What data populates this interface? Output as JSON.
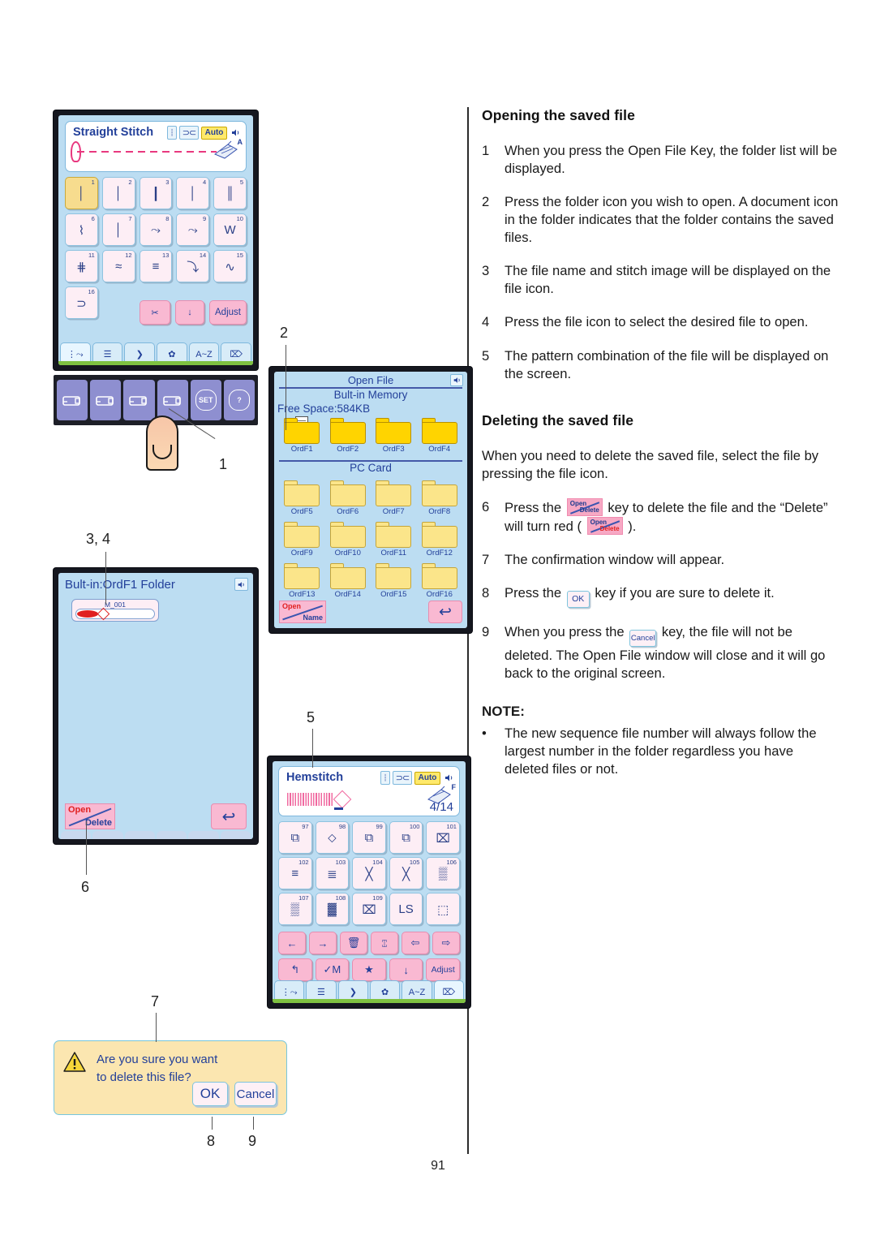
{
  "page": {
    "number": "91"
  },
  "sections": [
    {
      "heading": "Opening the saved file",
      "steps": [
        {
          "num": "1",
          "text": "When you press the Open File Key, the folder list will be displayed."
        },
        {
          "num": "2",
          "text": "Press the folder icon you wish to open. A document icon in the folder indicates that the folder contains the saved files."
        },
        {
          "num": "3",
          "text": "The file name and stitch image will be displayed on the file icon."
        },
        {
          "num": "4",
          "text": "Press the file icon to select the desired file to open."
        },
        {
          "num": "5",
          "text": "The pattern combination of the file will be displayed on the screen."
        }
      ]
    }
  ],
  "deleting": {
    "heading": "Deleting the saved file",
    "intro": "When you need to delete the saved file, select the file by pressing the file icon.",
    "step6_a": "Press the",
    "step6_b": "key to delete the file and the",
    "step6_c": "“Delete” will turn red (",
    "step6_d": ").",
    "step7": "The confirmation window will appear.",
    "step8_a": "Press the",
    "step8_b": "key if you are sure to delete it.",
    "step9_a": "When you press the",
    "step9_b": "key, the file will not be deleted.",
    "step9_c": "The Open File window will close and it will go back to the original screen.",
    "nums": {
      "n6": "6",
      "n7": "7",
      "n8": "8",
      "n9": "9"
    },
    "keys": {
      "open": "Open",
      "delete": "Delete",
      "ok": "OK",
      "cancel": "Cancel"
    }
  },
  "note": {
    "title": "NOTE:",
    "bullet_char": "•",
    "text": "The new sequence file number will always follow the largest number in the folder regardless you have deleted files or not."
  },
  "screen1": {
    "title": "Straight Stitch",
    "indicators": {
      "needle": "needle-position",
      "width": "⊃⊂",
      "auto": "Auto",
      "speaker": "◂"
    },
    "foot_letter": "A",
    "stitches": [
      {
        "n": "1",
        "g": "│",
        "sel": true
      },
      {
        "n": "2",
        "g": "│"
      },
      {
        "n": "3",
        "g": "┃"
      },
      {
        "n": "4",
        "g": "│"
      },
      {
        "n": "5",
        "g": "║"
      },
      {
        "n": "6",
        "g": "⌇"
      },
      {
        "n": "7",
        "g": "│"
      },
      {
        "n": "8",
        "g": "⤳"
      },
      {
        "n": "9",
        "g": "⤳"
      },
      {
        "n": "10",
        "g": "W"
      },
      {
        "n": "11",
        "g": "⋕"
      },
      {
        "n": "12",
        "g": "≈"
      },
      {
        "n": "13",
        "g": "≡"
      },
      {
        "n": "14",
        "g": "⤵"
      },
      {
        "n": "15",
        "g": "∿"
      },
      {
        "n": "16",
        "g": "⊃"
      }
    ],
    "fn_keys": [
      {
        "label": "✂",
        "name": "thread-cut-key"
      },
      {
        "label": "↓",
        "name": "needle-up-down-key"
      },
      {
        "label": "Adjust",
        "name": "adjust-key"
      }
    ],
    "tabs": [
      {
        "label": "⋮⤳",
        "name": "tab-utility-stitch",
        "active": true
      },
      {
        "label": "☰",
        "name": "tab-buttonhole"
      },
      {
        "label": "❯",
        "name": "tab-applique"
      },
      {
        "label": "✿",
        "name": "tab-decorative"
      },
      {
        "label": "A~Z",
        "name": "tab-monogram"
      },
      {
        "label": "⌦",
        "name": "tab-shirt"
      }
    ],
    "hard_keys": [
      {
        "label": "⎙",
        "name": "machine-mode-key"
      },
      {
        "label": "⎙",
        "name": "embroidery-key"
      },
      {
        "label": "⎙",
        "name": "pc-link-key"
      },
      {
        "label": "⎙",
        "name": "open-file-key"
      },
      {
        "label": "SET",
        "name": "set-key"
      },
      {
        "label": "?",
        "name": "help-key"
      }
    ]
  },
  "screen2": {
    "title": "Open File",
    "section_builtin": "Bult-in Memory",
    "free_space": "Free Space:584KB",
    "section_pccard": "PC Card",
    "builtin_folders": [
      {
        "name": "OrdF1",
        "has_doc": true,
        "filled": true
      },
      {
        "name": "OrdF2",
        "has_doc": false,
        "filled": true
      },
      {
        "name": "OrdF3",
        "has_doc": false,
        "filled": true
      },
      {
        "name": "OrdF4",
        "has_doc": false,
        "filled": true
      }
    ],
    "pccard_folders": [
      {
        "name": "OrdF5"
      },
      {
        "name": "OrdF6"
      },
      {
        "name": "OrdF7"
      },
      {
        "name": "OrdF8"
      },
      {
        "name": "OrdF9"
      },
      {
        "name": "OrdF10"
      },
      {
        "name": "OrdF11"
      },
      {
        "name": "OrdF12"
      },
      {
        "name": "OrdF13"
      },
      {
        "name": "OrdF14"
      },
      {
        "name": "OrdF15"
      },
      {
        "name": "OrdF16"
      }
    ],
    "open_key": {
      "top": "Open",
      "bottom": "Name"
    },
    "back_key": "↩"
  },
  "screen3": {
    "title": "Bult-in:OrdF1 Folder",
    "file": {
      "name": "M_001"
    },
    "open_delete_key": {
      "top": "Open",
      "bottom": "Delete"
    },
    "back_key": "↩"
  },
  "screen4": {
    "title": "Hemstitch",
    "indicators": {
      "width": "⊃⊂",
      "auto": "Auto"
    },
    "foot_letter": "F",
    "counter": "4/14",
    "stitches": [
      {
        "n": "97",
        "g": "⧉"
      },
      {
        "n": "98",
        "g": "⬦"
      },
      {
        "n": "99",
        "g": "⧉"
      },
      {
        "n": "100",
        "g": "⧉"
      },
      {
        "n": "101",
        "g": "⌧"
      },
      {
        "n": "102",
        "g": "≡"
      },
      {
        "n": "103",
        "g": "≣"
      },
      {
        "n": "104",
        "g": "╳"
      },
      {
        "n": "105",
        "g": "╳"
      },
      {
        "n": "106",
        "g": "▒"
      },
      {
        "n": "107",
        "g": "▒"
      },
      {
        "n": "108",
        "g": "▓"
      },
      {
        "n": "109",
        "g": "⌧"
      },
      {
        "n": "",
        "g": "LS"
      },
      {
        "n": "",
        "g": "⬚"
      }
    ],
    "fn_row1": [
      {
        "label": "←",
        "name": "cursor-left-key"
      },
      {
        "label": "→",
        "name": "cursor-right-key"
      },
      {
        "label": "🗑",
        "name": "delete-key"
      },
      {
        "label": "⑄",
        "name": "mirror-key"
      },
      {
        "label": "⇦",
        "name": "page-prev-key"
      },
      {
        "label": "⇨",
        "name": "page-next-key"
      }
    ],
    "fn_row2": [
      {
        "label": "↰",
        "name": "save-file-key"
      },
      {
        "label": "✓M",
        "name": "memory-key"
      },
      {
        "label": "★",
        "name": "favorite-key"
      },
      {
        "label": "↓",
        "name": "needle-up-down-key"
      },
      {
        "label": "Adjust",
        "name": "adjust-key"
      }
    ],
    "tabs": [
      {
        "label": "⋮⤳",
        "name": "tab-utility-stitch"
      },
      {
        "label": "☰",
        "name": "tab-buttonhole"
      },
      {
        "label": "❯",
        "name": "tab-applique"
      },
      {
        "label": "✿",
        "name": "tab-decorative"
      },
      {
        "label": "A~Z",
        "name": "tab-monogram"
      },
      {
        "label": "⌦",
        "name": "tab-shirt",
        "active": true
      }
    ]
  },
  "dialog": {
    "line1": "Are you sure you want",
    "line2": "to delete this file?",
    "ok": "OK",
    "cancel": "Cancel",
    "warn_glyph": "!"
  },
  "callouts": {
    "c1": "1",
    "c2": "2",
    "c34": "3, 4",
    "c5": "5",
    "c6": "6",
    "c7": "7",
    "c8": "8",
    "c9": "9"
  },
  "colors": {
    "lcd_bg": "#bcddf2",
    "pink_key": "#f9b9d2",
    "blue_text": "#23409a",
    "folder_yellow": "#ffd400",
    "folder_pale": "#fbe58a",
    "dialog_bg": "#fbe6b0",
    "accent_red": "#e02020"
  }
}
